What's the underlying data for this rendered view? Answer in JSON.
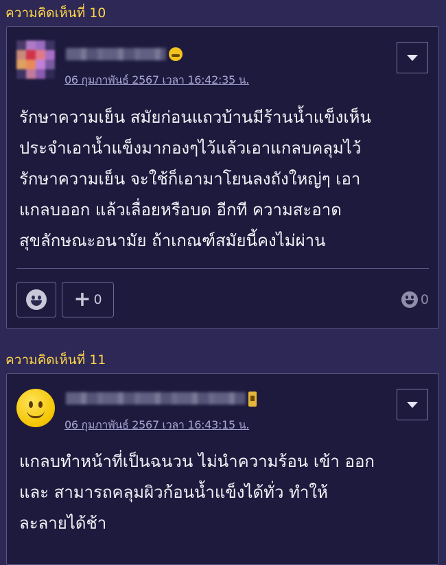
{
  "comments": [
    {
      "label": "ความคิดเห็นที่ 10",
      "timestamp": "06 กุมภาพันธ์ 2567 เวลา 16:42:35 น.",
      "text": "รักษาความเย็น สมัยก่อนแถวบ้านมีร้านน้ำแข็งเห็น\nประจำเอาน้ำแข็งมากองๆไว้แล้วเอาแกลบคลุมไว้\nรักษาความเย็น จะใช้ก็เอามาโยนลงถังใหญ่ๆ เอา\nแกลบออก แล้วเลื่อยหรือบด อีกที ความสะอาด\nสุขลักษณะอนามัย ถ้าเกณฑ์สมัยนี้คงไม่ผ่าน",
      "plus_count": "0",
      "emoji_count": "0",
      "avatar_icon": "pixelated-avatar",
      "badge_icon": "laughing-emoji-icon"
    },
    {
      "label": "ความคิดเห็นที่ 11",
      "timestamp": "06 กุมภาพันธ์ 2567 เวลา 16:43:15 น.",
      "text": "แกลบทำหน้าที่เป็นฉนวน ไม่นำความร้อน เข้า ออก\nและ สามารถคลุมผิวก้อนน้ำแข็งได้ทั่ว ทำให้\nละลายได้ช้า",
      "avatar_icon": "yellow-smiley-avatar",
      "badge_icon": "member-badge-icon"
    }
  ],
  "colors": {
    "background": "#2d2855",
    "card": "#1d1a3d",
    "label": "#ffd54a",
    "timestamp": "#a9a6d6"
  }
}
